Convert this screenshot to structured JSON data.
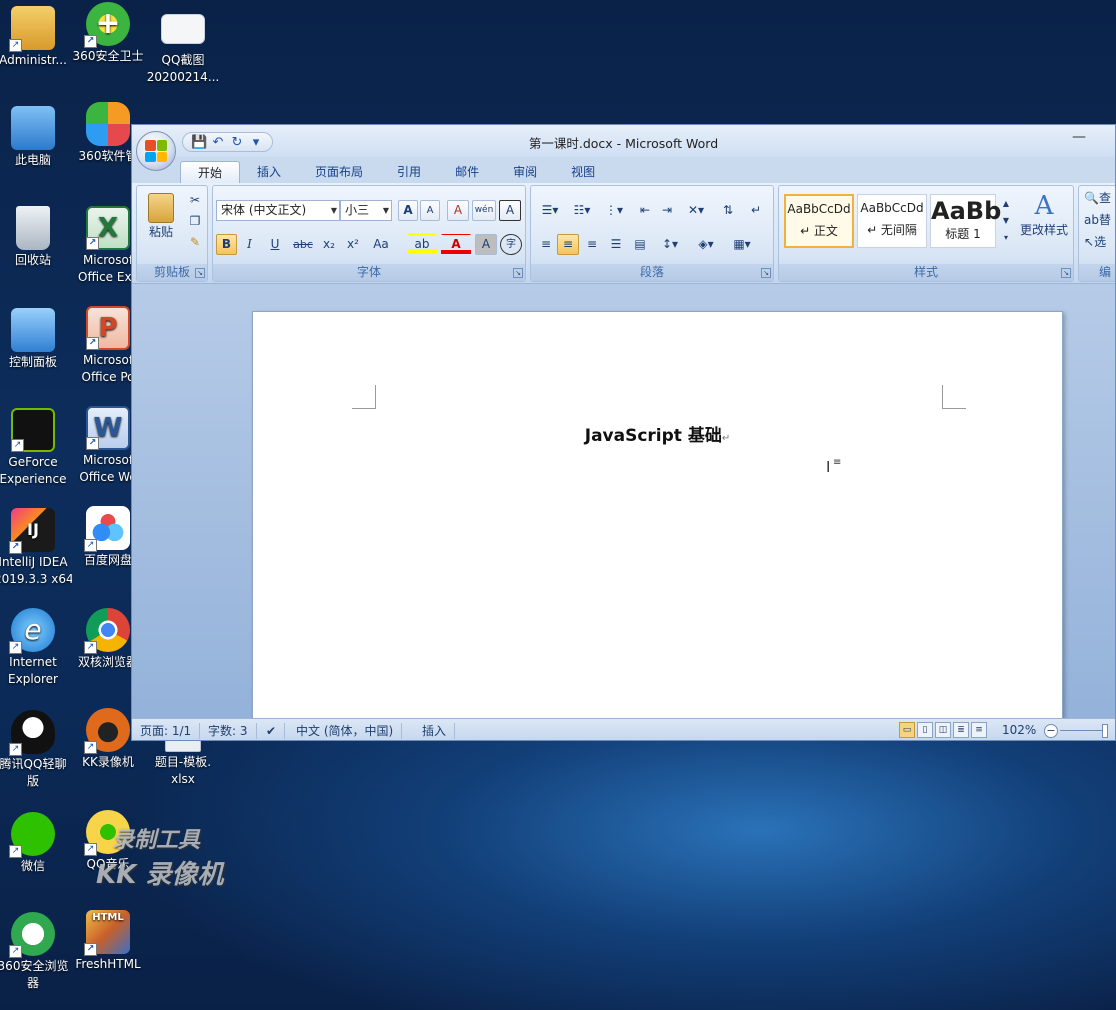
{
  "desktop": {
    "icons": [
      {
        "label": "Administr...",
        "icon": "user-folder-icon",
        "color": "#e8b84a"
      },
      {
        "label": "360安全卫士",
        "icon": "shield-plus-icon",
        "color": "#3cb540"
      },
      {
        "label": "QQ截图",
        "label2": "20200214...",
        "icon": "image-file-icon",
        "color": "#f2f2f2"
      },
      {
        "label": "此电脑",
        "icon": "computer-icon",
        "color": "#3e8ede"
      },
      {
        "label": "360软件管",
        "icon": "app-store-icon",
        "color": "#f59a23",
        "badge": "1"
      },
      {
        "label": "回收站",
        "icon": "recycle-bin-icon",
        "color": "#cfd8e0"
      },
      {
        "label": "Microsof",
        "label2": "Office Exc",
        "icon": "excel-icon",
        "color": "#1f7a3a"
      },
      {
        "label": "控制面板",
        "icon": "control-panel-icon",
        "color": "#3a8bd8"
      },
      {
        "label": "Microsof",
        "label2": "Office Po",
        "icon": "powerpoint-icon",
        "color": "#d24726"
      },
      {
        "label": "GeForce",
        "label2": "Experience",
        "icon": "nvidia-icon",
        "color": "#76b900"
      },
      {
        "label": "Microsof",
        "label2": "Office Wo",
        "icon": "word-icon",
        "color": "#2b5797"
      },
      {
        "label": "IntelliJ IDEA",
        "label2": "2019.3.3 x64",
        "icon": "intellij-icon",
        "color": "#1a1a1a"
      },
      {
        "label": "百度网盘",
        "icon": "baidu-pan-icon",
        "color": "#2f8df5"
      },
      {
        "label": "Internet",
        "label2": "Explorer",
        "icon": "ie-icon",
        "color": "#1e90e0"
      },
      {
        "label": "双核浏览器",
        "icon": "chrome-icon",
        "color": "#db4437"
      },
      {
        "label": "腾讯QQ轻聊",
        "label2": "版",
        "icon": "qq-icon",
        "color": "#111111"
      },
      {
        "label": "KK录像机",
        "icon": "kk-recorder-icon",
        "color": "#e06a1b"
      },
      {
        "label": "题目-模板.",
        "label2": "xlsx",
        "icon": "xlsx-file-icon",
        "color": "#e9eef3"
      },
      {
        "label": "微信",
        "icon": "wechat-icon",
        "color": "#2dc100"
      },
      {
        "label": "QQ音乐",
        "icon": "qq-music-icon",
        "color": "#f7d44a"
      },
      {
        "label": "360安全浏览",
        "label2": "器",
        "icon": "360-browser-icon",
        "color": "#2fa84f"
      },
      {
        "label": "FreshHTML",
        "icon": "freshhtml-icon",
        "color": "#c8602a"
      }
    ],
    "watermark": {
      "line1": "录制工具",
      "line2": "KK 录像机"
    }
  },
  "word": {
    "window_title": "第一课时.docx - Microsoft Word",
    "minimize": "—",
    "qat": {
      "save": "💾",
      "undo": "↶",
      "redo": "↻",
      "more": "▾"
    },
    "tabs": [
      "开始",
      "插入",
      "页面布局",
      "引用",
      "邮件",
      "审阅",
      "视图"
    ],
    "active_tab": "开始",
    "ribbon": {
      "clipboard": {
        "label": "剪贴板",
        "paste": "粘贴"
      },
      "font": {
        "label": "字体",
        "font_name": "宋体 (中文正文)",
        "font_size": "小三",
        "bold": "B",
        "italic": "I",
        "underline": "U",
        "strike": "abc",
        "subscript": "x₂",
        "superscript": "x²",
        "change_case": "Aa",
        "grow": "A",
        "shrink": "A",
        "clear": "A",
        "phonetic": "wén",
        "border": "A",
        "highlight": "ab",
        "font_color": "A",
        "shading": "A",
        "enclose": "字"
      },
      "paragraph": {
        "label": "段落"
      },
      "styles": {
        "label": "样式",
        "items": [
          {
            "sample": "AaBbCcDd",
            "name": "↵ 正文",
            "selected": true
          },
          {
            "sample": "AaBbCcDd",
            "name": "↵ 无间隔",
            "selected": false
          },
          {
            "sample": "AaBb",
            "name": "标题 1",
            "selected": false
          }
        ],
        "change_styles": "更改样式"
      },
      "editing": {
        "label": "编",
        "find": "查",
        "replace": "替",
        "select": "选"
      }
    },
    "document": {
      "title": "JavaScript 基础",
      "para_mark": "↵"
    },
    "status": {
      "page": "页面: 1/1",
      "words": "字数: 3",
      "language": "中文 (简体，中国)",
      "mode": "插入",
      "zoom": "102%"
    },
    "zoom_level": 102,
    "colors": {
      "ribbon_accent": "#15428b",
      "selected_style_border": "#f0b23c"
    }
  }
}
